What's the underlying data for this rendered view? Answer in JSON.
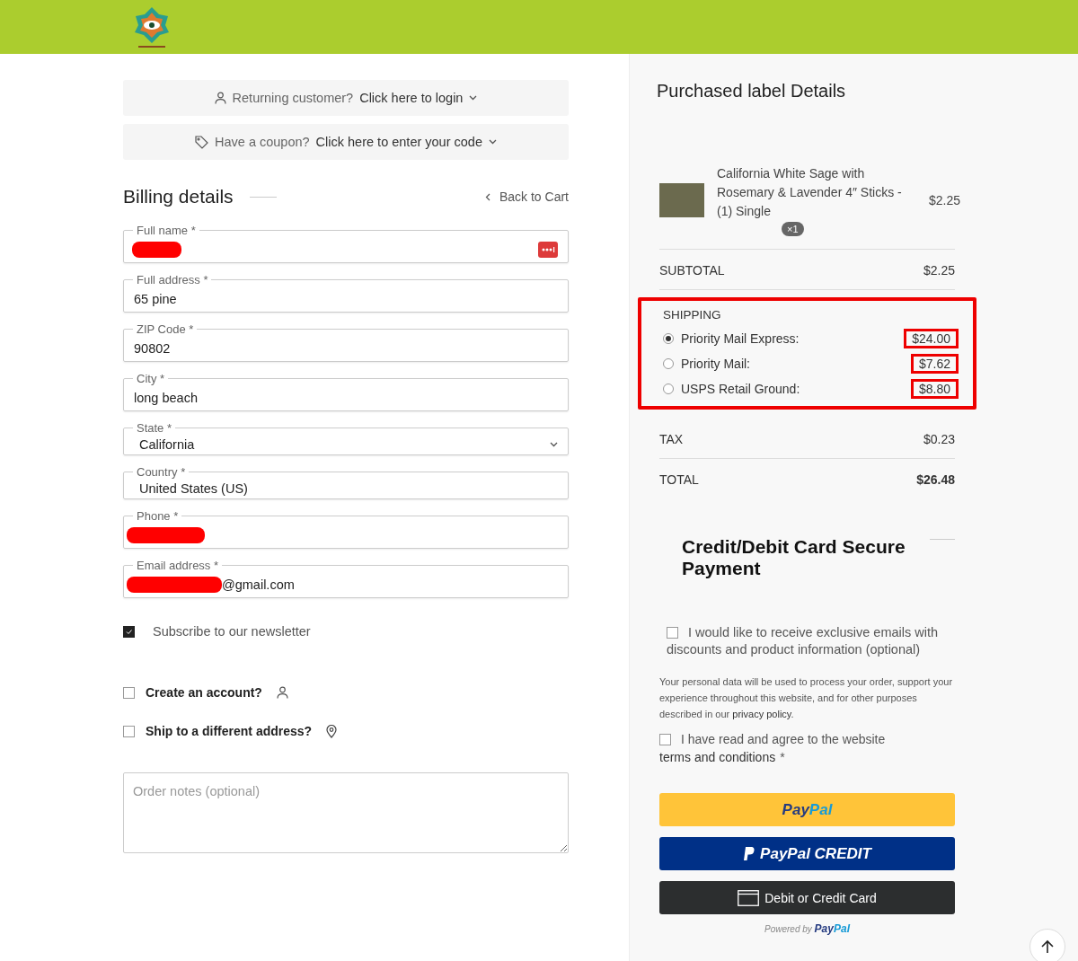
{
  "notices": [
    {
      "kind": "login",
      "prefix": "Returning customer?",
      "link": "Click here to login"
    },
    {
      "kind": "coupon",
      "prefix": "Have a coupon?",
      "link": "Click here to enter your code"
    }
  ],
  "billing": {
    "title": "Billing details",
    "back_link": "Back to Cart",
    "fields": [
      {
        "kind": "text",
        "label": "Full name *",
        "redacted": true,
        "autofill_icon": true
      },
      {
        "kind": "text",
        "label": "Full address  *",
        "value": "65 pine"
      },
      {
        "kind": "text",
        "label": "ZIP Code  *",
        "value": "90802"
      },
      {
        "kind": "text",
        "label": "City  *",
        "value": "long beach"
      },
      {
        "kind": "select",
        "label": "State  *",
        "value": "California"
      },
      {
        "kind": "static",
        "label": "Country  *",
        "value": "United States (US)"
      },
      {
        "kind": "text",
        "label": "Phone *",
        "redacted": true
      },
      {
        "kind": "text",
        "label": "Email address *",
        "redacted": true,
        "value": "@gmail.com"
      }
    ],
    "checkboxes": [
      {
        "kind": "newsletter",
        "label": "Subscribe to our newsletter",
        "checked": true
      },
      {
        "kind": "account",
        "label": "Create an account?",
        "checked": false
      },
      {
        "kind": "shipping",
        "label": "Ship to a different address?",
        "checked": false
      }
    ],
    "order_notes": {
      "placeholder": "Order notes (optional)"
    }
  },
  "summary": {
    "title": "Purchased label Details",
    "items": [
      {
        "name": "California White Sage with Rosemary & Lavender 4″ Sticks - (1) Single",
        "quantity": "×1",
        "price": "$2.25"
      }
    ],
    "subtotal": {
      "label": "SUBTOTAL",
      "value": "$2.25"
    },
    "shipping": {
      "label": "SHIPPING",
      "highlighted": true,
      "options": [
        {
          "label": "Priority Mail Express:",
          "price": "$24.00",
          "selected": true,
          "price_highlighted": true
        },
        {
          "label": "Priority Mail:",
          "price": "$7.62",
          "selected": false,
          "price_highlighted": true
        },
        {
          "label": "USPS Retail Ground:",
          "price": "$8.80",
          "selected": false,
          "price_highlighted": true
        }
      ]
    },
    "tax": {
      "label": "TAX",
      "value": "$0.23"
    },
    "total": {
      "label": "TOTAL",
      "value": "$26.48"
    }
  },
  "payment": {
    "title": "Credit/Debit Card Secure Payment",
    "email_optin": {
      "label": "I would like to receive exclusive emails with discounts and product information (optional)",
      "checked": false
    },
    "privacy_text": "Your personal data will be used to process your order, support your experience throughout this website, and for other purposes described in our",
    "privacy_link": "privacy policy",
    "privacy_end": ".",
    "terms": {
      "text": "I have read and agree to the website",
      "link": "terms and conditions",
      "star": "*",
      "checked": false
    },
    "buttons": [
      {
        "kind": "paypal",
        "parts": [
          "Pay",
          "Pal"
        ]
      },
      {
        "kind": "credit",
        "parts": [
          "PayPal CREDIT"
        ]
      },
      {
        "kind": "card",
        "parts": [
          "Debit or Credit Card"
        ]
      }
    ],
    "powered_by": {
      "text": "Powered by",
      "parts": [
        "Pay",
        "Pal"
      ]
    }
  }
}
